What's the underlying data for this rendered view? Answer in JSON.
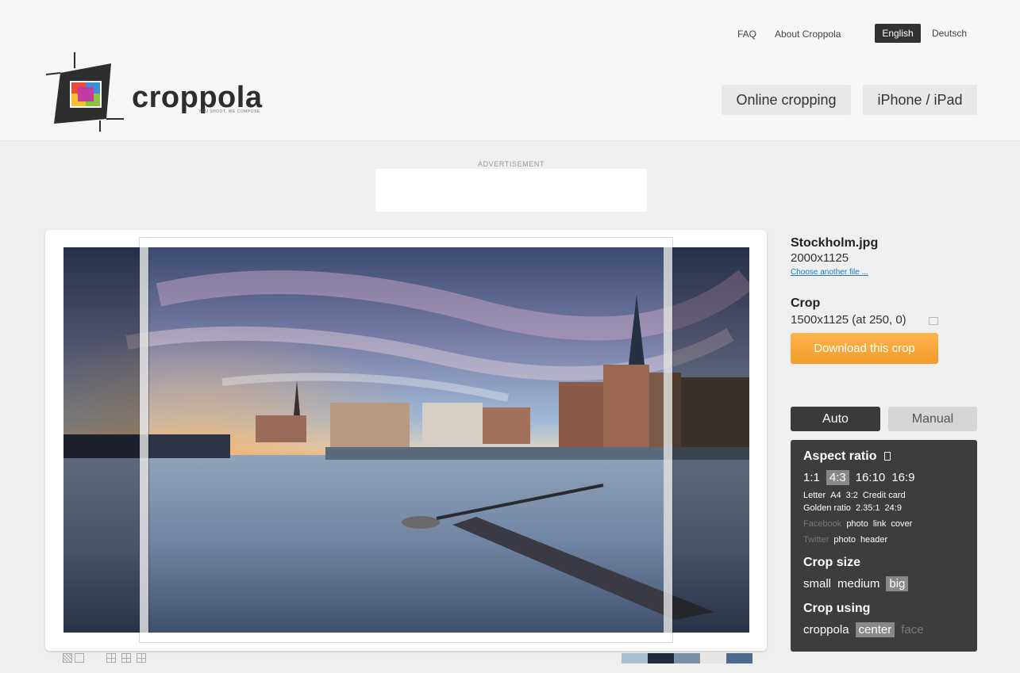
{
  "header": {
    "logo_text": "croppola",
    "logo_tagline": "YOU SHOOT, WE COMPOSE",
    "nav": [
      {
        "label": "FAQ"
      },
      {
        "label": "About Croppola"
      }
    ],
    "languages": {
      "active": "English",
      "other": "Deutsch"
    },
    "tabs": [
      {
        "label": "Online cropping"
      },
      {
        "label": "iPhone / iPad"
      }
    ]
  },
  "ad": {
    "label": "ADVERTISEMENT"
  },
  "file": {
    "name": "Stockholm.jpg",
    "dimensions": "2000x1125",
    "choose_link": "Choose another file ..."
  },
  "crop": {
    "heading": "Crop",
    "value": "1500x1125 (at 250, 0)",
    "download_label": "Download this crop"
  },
  "mode": {
    "auto": "Auto",
    "manual": "Manual",
    "active": "Auto"
  },
  "options": {
    "aspect_heading": "Aspect ratio",
    "ratios_main": [
      "1:1",
      "4:3",
      "16:10",
      "16:9"
    ],
    "ratio_selected": "4:3",
    "ratios_row2": [
      "Letter",
      "A4",
      "3:2",
      "Credit card"
    ],
    "ratios_row3": [
      "Golden ratio",
      "2.35:1",
      "24:9"
    ],
    "facebook": {
      "label": "Facebook",
      "items": [
        "photo",
        "link",
        "cover"
      ]
    },
    "twitter": {
      "label": "Twitter",
      "items": [
        "photo",
        "header"
      ]
    },
    "size_heading": "Crop size",
    "sizes": [
      "small",
      "medium",
      "big"
    ],
    "size_selected": "big",
    "using_heading": "Crop using",
    "using": [
      "croppola",
      "center",
      "face"
    ],
    "using_selected": "center"
  },
  "palette": [
    "#a8bfd3",
    "#1f2a3a",
    "#7890a8",
    "#e6e6e6",
    "#4c6a8c"
  ]
}
